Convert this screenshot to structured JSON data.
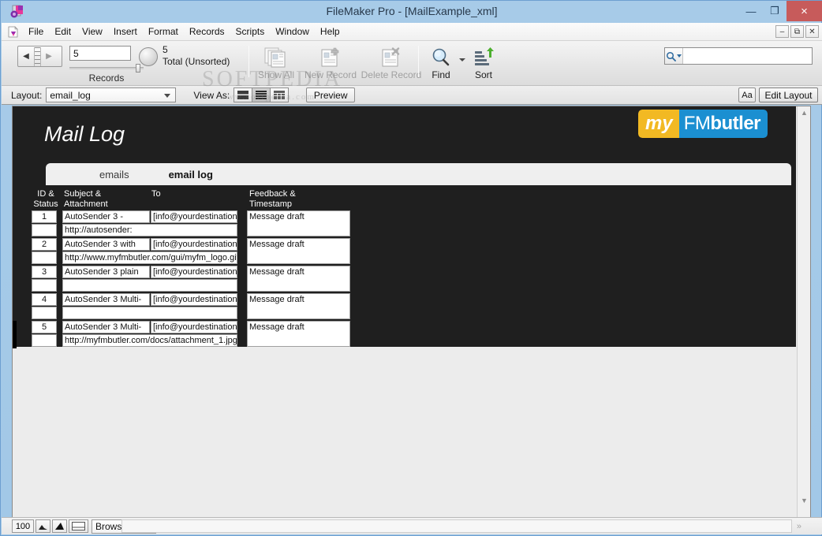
{
  "window": {
    "title": "FileMaker Pro - [MailExample_xml]",
    "app_icon": "filemaker-logo-icon",
    "minimize": "—",
    "maximize": "❐",
    "close": "×"
  },
  "mdi": {
    "minimize": "–",
    "restore": "⧉",
    "close": "✕"
  },
  "menu": {
    "doc_icon": "document-icon",
    "items": [
      {
        "label": "File"
      },
      {
        "label": "Edit"
      },
      {
        "label": "View"
      },
      {
        "label": "Insert"
      },
      {
        "label": "Format"
      },
      {
        "label": "Records"
      },
      {
        "label": "Scripts"
      },
      {
        "label": "Window"
      },
      {
        "label": "Help"
      }
    ]
  },
  "toolbar": {
    "record_number": "5",
    "records_label": "Records",
    "total_count": "5",
    "total_label": "Total (Unsorted)",
    "nav_prev": "◀",
    "nav_next": "▶",
    "buttons": [
      {
        "label": "Show All",
        "icon": "show-all-records-icon",
        "enabled": false
      },
      {
        "label": "New Record",
        "icon": "new-record-icon",
        "enabled": false
      },
      {
        "label": "Delete Record",
        "icon": "delete-record-icon",
        "enabled": false
      },
      {
        "label": "Find",
        "icon": "magnifier-icon",
        "enabled": true
      },
      {
        "label": "Sort",
        "icon": "sort-icon",
        "enabled": true
      }
    ],
    "quick_search_placeholder": "",
    "quick_search_value": "",
    "quick_search_icon": "search-icon"
  },
  "layoutbar": {
    "layout_label": "Layout:",
    "layout_value": "email_log",
    "viewas_label": "View As:",
    "view_modes": [
      {
        "name": "form-view",
        "active": false
      },
      {
        "name": "list-view",
        "active": true
      },
      {
        "name": "table-view",
        "active": false
      }
    ],
    "preview_label": "Preview",
    "text_format_label": "Aa",
    "edit_layout_label": "Edit Layout"
  },
  "watermark": {
    "line1": "SOFTPEDIA",
    "line2": "www.softpedia.com"
  },
  "content": {
    "page_title": "Mail Log",
    "brand": {
      "part1": "my",
      "part2_light": "FM",
      "part2_bold": "butler"
    },
    "tabs": [
      {
        "label": "emails",
        "active": false
      },
      {
        "label": "email log",
        "active": true
      }
    ],
    "columns": [
      {
        "line1": "ID &",
        "line2": "Status"
      },
      {
        "line1": "Subject &",
        "line2": "Attachment"
      },
      {
        "line1": "To",
        "line2": ""
      },
      {
        "line1": "Feedback &",
        "line2": "Timestamp"
      }
    ],
    "rows": [
      {
        "id": "1",
        "status": "",
        "subject": "AutoSender 3 -",
        "attachment": "http://autosender:",
        "to": "[info@yourdestination.",
        "feedback": "Message draft",
        "current": false
      },
      {
        "id": "2",
        "status": "",
        "subject": "AutoSender 3 with",
        "attachment": "http://www.myfmbutler.com/gui/myfm_logo.gif",
        "to": "[info@yourdestination.",
        "feedback": "Message draft",
        "current": false
      },
      {
        "id": "3",
        "status": "",
        "subject": "AutoSender 3 plain",
        "attachment": "",
        "to": "[info@yourdestination.",
        "feedback": "Message draft",
        "current": false
      },
      {
        "id": "4",
        "status": "",
        "subject": "AutoSender 3 Multi-",
        "attachment": "",
        "to": "[info@yourdestination.",
        "feedback": "Message draft",
        "current": false
      },
      {
        "id": "5",
        "status": "",
        "subject": "AutoSender 3 Multi-",
        "attachment": "http://myfmbutler.com/docs/attachment_1.jpg",
        "to": "[info@yourdestination.",
        "feedback": "Message draft",
        "current": true
      }
    ]
  },
  "statusbar": {
    "zoom_level": "100",
    "zoom_out_icon": "zoom-out-icon",
    "zoom_in_icon": "zoom-in-icon",
    "status_toggle_icon": "status-area-toggle-icon",
    "mode": "Browse",
    "scroll_left_icon": "«",
    "scroll_right_icon": "»"
  },
  "colors": {
    "titlebar": "#a7cbe8",
    "close_button": "#c75b5b",
    "dark_panel": "#1f1f1f",
    "brand_yellow": "#f2b923",
    "brand_blue": "#1b8fd1",
    "content_bg": "#ececec"
  }
}
